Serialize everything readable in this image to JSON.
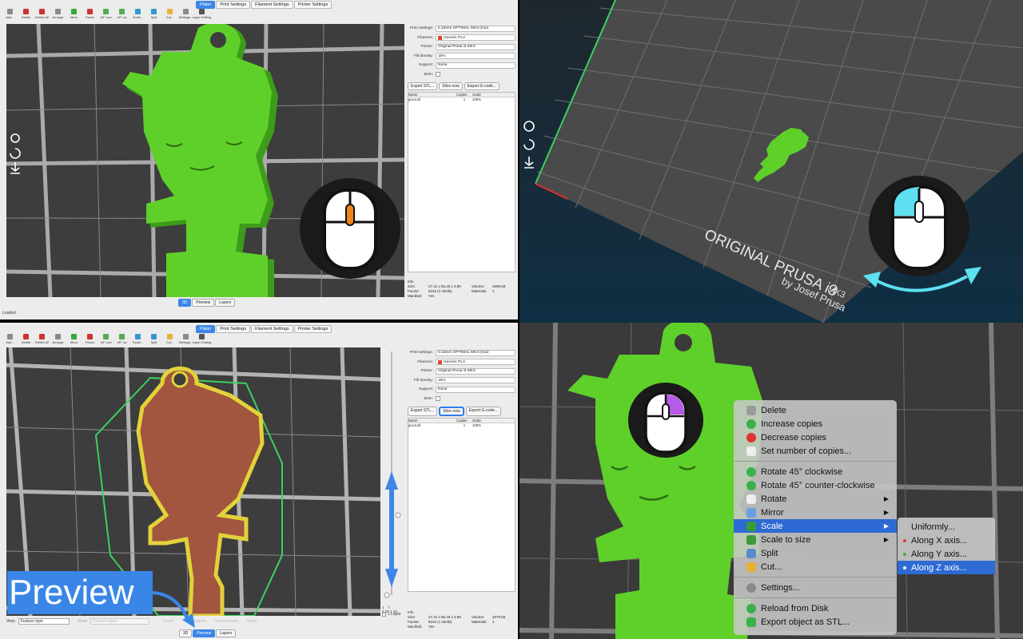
{
  "tabs": [
    "Plater",
    "Print Settings",
    "Filament Settings",
    "Printer Settings"
  ],
  "toolbar": [
    "Add...",
    "Delete",
    "Delete All",
    "Arrange",
    "More",
    "Fewer",
    "45° ccw",
    "45° cw",
    "Scale...",
    "Split",
    "Cut...",
    "Settings...",
    "Layer Editing"
  ],
  "settings": {
    "print_label": "Print settings:",
    "print_value": "0.15mm OPTIMAL MK3 (mod",
    "filament_label": "Filament:",
    "filament_value": "Generic PLA",
    "printer_label": "Printer:",
    "printer_value": "Original Prusa i3 MK3",
    "fill_label": "Fill density:",
    "fill_value": "15%",
    "support_label": "Support:",
    "support_value": "None",
    "brim_label": "Brim:"
  },
  "buttons": {
    "export_stl": "Export STL...",
    "slice_now": "Slice now",
    "export_gcode": "Export G-code..."
  },
  "object_list": {
    "headers": [
      "Name",
      "Copies",
      "Scale"
    ],
    "row": [
      "groot.stl",
      "1",
      "100%"
    ]
  },
  "view_buttons": [
    "3D",
    "Preview",
    "Layers"
  ],
  "status_text": "Loaded",
  "info1": {
    "title": "Info",
    "size_label": "Size:",
    "size": "27.31 x 55.18 x 3.80",
    "volume_label": "Volume:",
    "volume": "2599.58",
    "facets_label": "Facets:",
    "facets": "8243 (1 shells)",
    "materials_label": "Materials:",
    "materials": "1",
    "manifold_label": "Manifold:",
    "manifold": "Yes"
  },
  "info2": {
    "title": "Info",
    "size_label": "Size:",
    "size": "27.31 x 55.18 x 2.88",
    "volume_label": "Volume:",
    "volume": "2079.66",
    "facets_label": "Facets:",
    "facets": "8243 (1 shells)",
    "materials_label": "Materials:",
    "materials": "1",
    "manifold_label": "Manifold:",
    "manifold": "Yes"
  },
  "preview": {
    "view_label": "View",
    "view_value": "Feature type",
    "show_label": "Show",
    "show_value": "Feature types",
    "checks": [
      "Travel",
      "Retractions",
      "Unretractions",
      "Shells"
    ],
    "slider_top": "7",
    "slider_top2": "1.10",
    "slider_bot": "1",
    "slider_bot2": "0.20",
    "one_layer": "1 Layer"
  },
  "callout_text": "Preview",
  "bed_text1": "ORIGINAL PRUSA i3",
  "bed_text_mk3": "MK3",
  "bed_text2": "by Josef Prusa",
  "context_menu": {
    "group1": [
      "Delete",
      "Increase copies",
      "Decrease copies",
      "Set number of copies..."
    ],
    "group2": [
      "Rotate 45° clockwise",
      "Rotate 45° counter-clockwise",
      "Rotate",
      "Mirror",
      "Scale",
      "Scale to size",
      "Split",
      "Cut..."
    ],
    "group3": [
      "Settings..."
    ],
    "group4": [
      "Reload from Disk",
      "Export object as STL..."
    ],
    "highlighted": "Scale"
  },
  "submenu": [
    "Uniformly...",
    "Along X axis...",
    "Along Y axis...",
    "Along Z axis..."
  ],
  "colors": {
    "accent": "#3d86e8",
    "model": "#5fd02a",
    "mouse_orange": "#f0851a",
    "mouse_cyan": "#5de0f0",
    "mouse_purple": "#b55be6"
  }
}
